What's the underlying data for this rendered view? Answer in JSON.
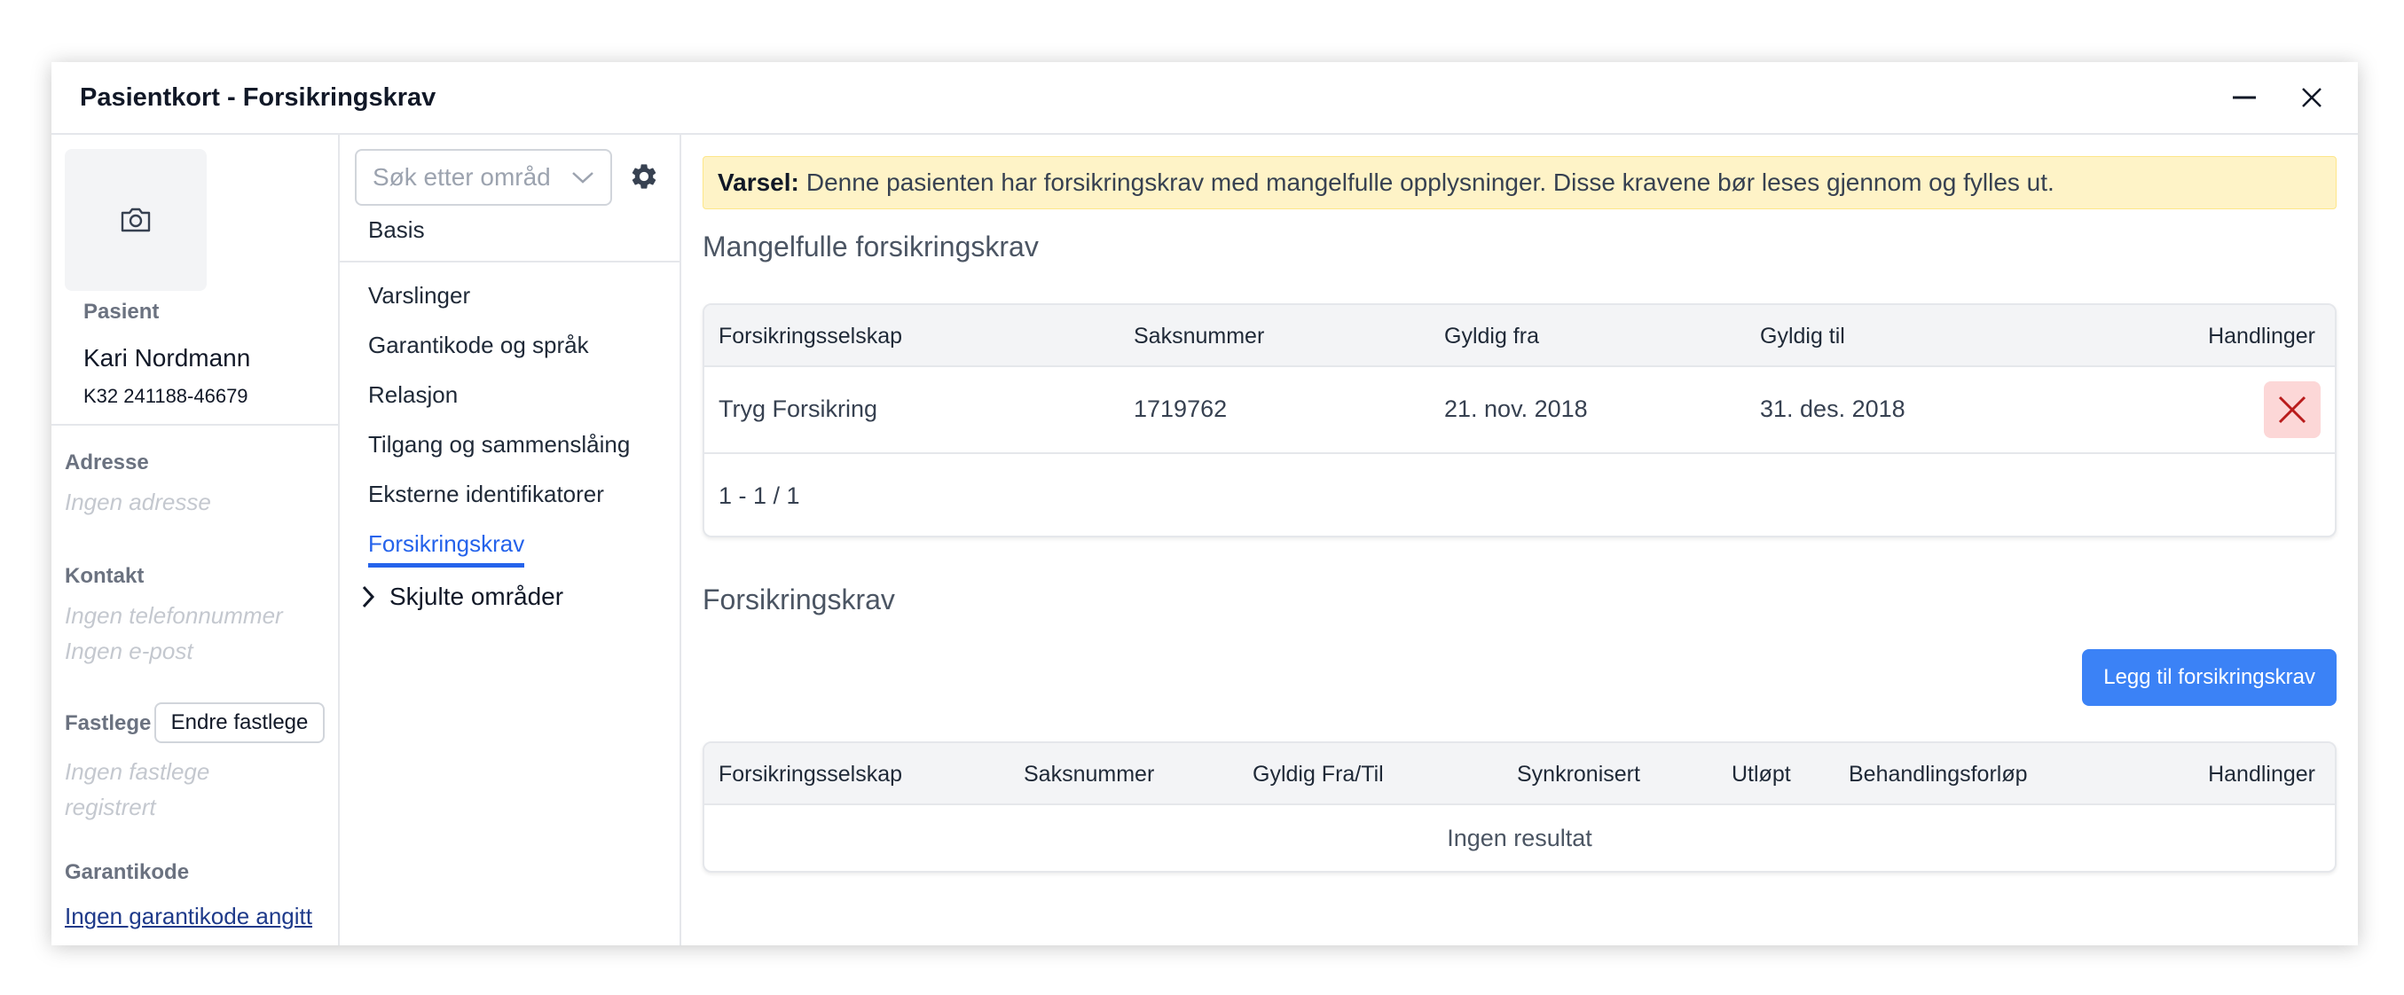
{
  "window": {
    "title": "Pasientkort - Forsikringskrav"
  },
  "patient": {
    "label": "Pasient",
    "name": "Kari Nordmann",
    "id": "K32 241188-46679",
    "address_label": "Adresse",
    "address_value": "Ingen adresse",
    "contact_label": "Kontakt",
    "phone_value": "Ingen telefonnummer",
    "email_value": "Ingen e-post",
    "gp_label": "Fastlege",
    "gp_button": "Endre fastlege",
    "gp_value_line1": "Ingen fastlege",
    "gp_value_line2": "registrert",
    "guarantee_label": "Garantikode",
    "guarantee_link": "Ingen garantikode angitt"
  },
  "nav": {
    "search_placeholder": "Søk etter områder",
    "basis": "Basis",
    "items": [
      {
        "label": "Varslinger"
      },
      {
        "label": "Garantikode og språk"
      },
      {
        "label": "Relasjon"
      },
      {
        "label": "Tilgang og sammenslåing"
      },
      {
        "label": "Eksterne identifikatorer"
      },
      {
        "label": "Forsikringskrav"
      }
    ],
    "active_index": 5,
    "hidden_areas": "Skjulte områder"
  },
  "alert": {
    "strong": "Varsel:",
    "text": "Denne pasienten har forsikringskrav med mangelfulle opplysninger. Disse kravene bør leses gjennom og fylles ut."
  },
  "incomplete": {
    "title": "Mangelfulle forsikringskrav",
    "columns": [
      "Forsikringsselskap",
      "Saksnummer",
      "Gyldig fra",
      "Gyldig til",
      "Handlinger"
    ],
    "rows": [
      {
        "company": "Tryg Forsikring",
        "case_no": "1719762",
        "valid_from": "21. nov. 2018",
        "valid_to": "31. des. 2018"
      }
    ],
    "pagination": "1 - 1 / 1"
  },
  "claims": {
    "title": "Forsikringskrav",
    "add_button": "Legg til forsikringskrav",
    "columns": [
      "Forsikringsselskap",
      "Saksnummer",
      "Gyldig Fra/Til",
      "Synkronisert",
      "Utløpt",
      "Behandlingsforløp",
      "Handlinger"
    ],
    "empty": "Ingen resultat"
  },
  "colors": {
    "accent": "#3b82f6",
    "alert_bg": "#fef3c7",
    "danger_bg": "#fcd7d7",
    "danger_icon": "#b91c1c"
  }
}
